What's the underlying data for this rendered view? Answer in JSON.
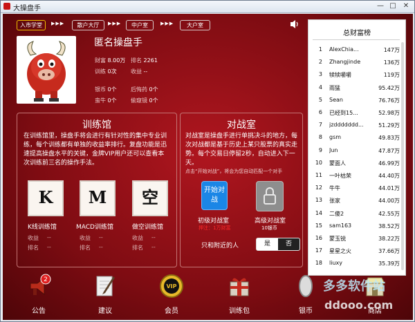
{
  "window": {
    "title": "大操盘手",
    "min": "—",
    "max": "□",
    "close": "✕"
  },
  "nav": {
    "items": [
      "入市学堂",
      "散户大厅",
      "中户室",
      "大户室"
    ],
    "arrows": "▶▶▶"
  },
  "profile": {
    "name": "匿名操盘手",
    "wealth_label": "财富",
    "wealth_value": "8.00万",
    "rank_label": "排名",
    "rank_value": "2261",
    "training_label": "训练",
    "training_value": "0次",
    "income_label": "收益",
    "income_value": "--",
    "silver_label": "银币",
    "silver_value": "0个",
    "regret_label": "后悔药",
    "regret_value": "0个",
    "bull_label": "蛮牛",
    "bull_value": "0个",
    "peek_label": "偷窥镜",
    "peek_value": "0个"
  },
  "training": {
    "title": "训练馆",
    "desc": "在训练馆里，操盘手将会进行有针对性的集中专业训练，每个训练都有单独的收益率排行。复盘功能是迅速提高操盘水平的关键，金牌VIP用户还可以查看本次训练前三名的操作手法。",
    "cards": [
      {
        "letter": "K",
        "label": "K线训练馆",
        "income": "收益",
        "income_v": "--",
        "rank": "排名",
        "rank_v": "--"
      },
      {
        "letter": "M",
        "label": "MACD训练馆",
        "income": "收益",
        "income_v": "--",
        "rank": "排名",
        "rank_v": "--"
      },
      {
        "letter": "空",
        "label": "做空训练馆",
        "income": "收益",
        "income_v": "--",
        "rank": "排名",
        "rank_v": "--"
      }
    ]
  },
  "battle": {
    "title": "对战室",
    "desc": "对战室是操盘手进行单挑决斗的地方，每次对战都是基于历史上某只股票的真实走势。每个交易日停留2秒，自动进入下一天。",
    "hint": "点击“开始对战”，将会为您自动匹配一个对手",
    "start_button": "开始对战",
    "junior_label": "初级对战室",
    "junior_fee": "押注：1万财富",
    "senior_label": "高级对战室",
    "senior_fee": "10银币",
    "nearby_label": "只和附近的人",
    "yes": "是",
    "no": "否"
  },
  "ranking": {
    "title": "总财富榜",
    "rows": [
      {
        "n": "1",
        "name": "AlexChia...",
        "v": "147万"
      },
      {
        "n": "2",
        "name": "Zhangjinde",
        "v": "136万"
      },
      {
        "n": "3",
        "name": "犊犊嚼嚼",
        "v": "119万"
      },
      {
        "n": "4",
        "name": "雨猛",
        "v": "95.42万"
      },
      {
        "n": "5",
        "name": "Sean",
        "v": "76.76万"
      },
      {
        "n": "6",
        "name": "已经到15...",
        "v": "52.98万"
      },
      {
        "n": "7",
        "name": "jzddddddd...",
        "v": "51.29万"
      },
      {
        "n": "8",
        "name": "gsm",
        "v": "49.83万"
      },
      {
        "n": "9",
        "name": "Jun",
        "v": "47.87万"
      },
      {
        "n": "10",
        "name": "蒙面人",
        "v": "46.99万"
      },
      {
        "n": "11",
        "name": "一叶枯荣",
        "v": "44.40万"
      },
      {
        "n": "12",
        "name": "牛牛",
        "v": "44.01万"
      },
      {
        "n": "13",
        "name": "张家",
        "v": "44.00万"
      },
      {
        "n": "14",
        "name": "二傻2",
        "v": "42.55万"
      },
      {
        "n": "15",
        "name": "sam163",
        "v": "38.52万"
      },
      {
        "n": "16",
        "name": "蒙玉锐",
        "v": "38.22万"
      },
      {
        "n": "17",
        "name": "星星之火",
        "v": "37.66万"
      },
      {
        "n": "18",
        "name": "liuxy",
        "v": "35.39万"
      }
    ]
  },
  "bottom": {
    "items": [
      {
        "label": "公告",
        "badge": "2"
      },
      {
        "label": "建议"
      },
      {
        "label": "会员",
        "vip": "VIP"
      },
      {
        "label": "训练包"
      },
      {
        "label": "银币"
      },
      {
        "label": "商店"
      }
    ]
  },
  "watermark": {
    "line1": "多多软件站",
    "line2": "ddooo.com"
  },
  "colors": {
    "accent_yellow": "#f2c300",
    "start_blue": "#1b86e6",
    "fee_red": "#e61b1b"
  }
}
